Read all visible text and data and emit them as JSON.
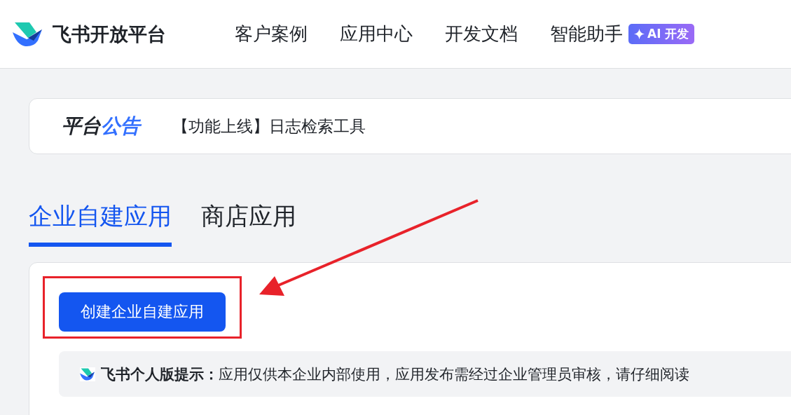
{
  "header": {
    "brand": "飞书开放平台",
    "nav": [
      {
        "label": "客户案例"
      },
      {
        "label": "应用中心"
      },
      {
        "label": "开发文档"
      },
      {
        "label": "智能助手",
        "badge": "AI 开发"
      }
    ]
  },
  "announcement": {
    "title_parts": [
      {
        "text": "平台",
        "accent": false
      },
      {
        "text": "公告",
        "accent": true
      }
    ],
    "message": "【功能上线】日志检索工具"
  },
  "tabs": [
    {
      "label": "企业自建应用",
      "selected": true
    },
    {
      "label": "商店应用",
      "selected": false
    }
  ],
  "panel": {
    "create_button": "创建企业自建应用",
    "notice": "**飞书个人版提示：**应用仅供本企业内部使用，应用发布需经过企业管理员审核，请仔细阅读"
  }
}
